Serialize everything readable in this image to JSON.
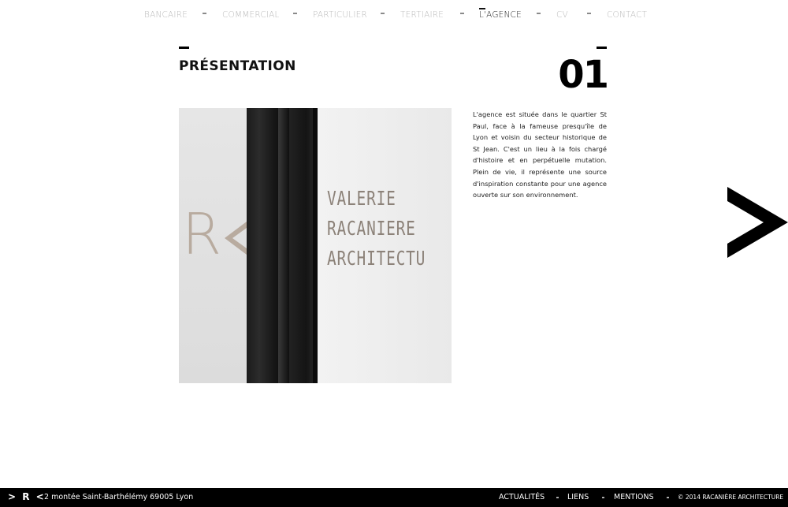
{
  "nav": {
    "items": [
      {
        "label": "BANCAIRE"
      },
      {
        "label": "COMMERCIAL"
      },
      {
        "label": "PARTICULIER"
      },
      {
        "label": "TERTIAIRE"
      },
      {
        "label": "L'AGENCE",
        "active": true
      },
      {
        "label": "CV"
      },
      {
        "label": "CONTACT"
      }
    ]
  },
  "section": {
    "title": "PRÉSENTATION",
    "number": "01"
  },
  "photo": {
    "sign_lines": [
      "VALERIE",
      "RACANIERE",
      "ARCHITECTU"
    ],
    "reflection_letter": "R"
  },
  "description": "L'agence est située dans le quartier St Paul, face à la fameuse presqu'île de Lyon et voisin du secteur historique de St Jean. C'est un lieu à la fois chargé d'histoire et en perpétuelle mutation. Plein de vie, il représente une source d'inspiration constante pour une agence ouverte sur son environnement.",
  "next_arrow": {
    "icon": "chevron-right-icon"
  },
  "footer": {
    "logo": "> R <",
    "address": "2 montée Saint-Barthélémy 69005 Lyon",
    "links": [
      {
        "label": "ACTUALITÉS"
      },
      {
        "label": "LIENS"
      },
      {
        "label": "MENTIONS"
      }
    ],
    "copyright": "© 2014 RACANIÈRE ARCHITECTURE"
  },
  "colors": {
    "background": "#ffffff",
    "nav_inactive": "#b9b9b9",
    "text": "#111111",
    "footer_bg": "#000000"
  }
}
